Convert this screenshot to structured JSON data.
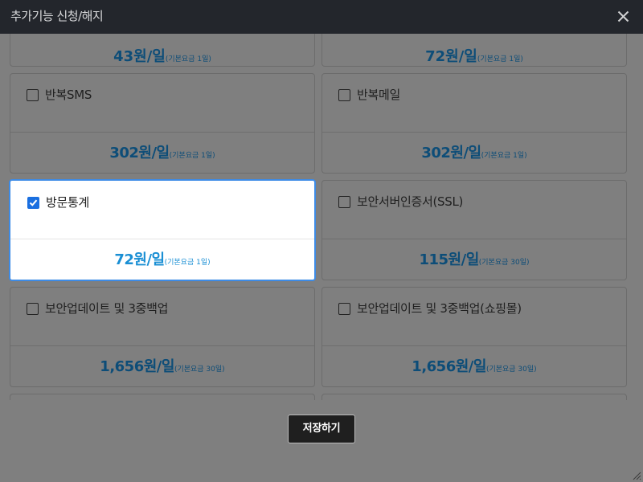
{
  "dialog": {
    "title": "추가기능 신청/해지",
    "close_icon": "close-icon"
  },
  "partial_top": [
    {
      "amount": "43원/일",
      "base": "(기본요금 1일)"
    },
    {
      "amount": "72원/일",
      "base": "(기본요금 1일)"
    }
  ],
  "options": [
    {
      "name": "반복SMS",
      "amount": "302원/일",
      "base": "(기본요금 1일)",
      "checked": false
    },
    {
      "name": "반복메일",
      "amount": "302원/일",
      "base": "(기본요금 1일)",
      "checked": false
    },
    {
      "name": "방문통계",
      "amount": "72원/일",
      "base": "(기본요금 1일)",
      "checked": true
    },
    {
      "name": "보안서버인증서(SSL)",
      "amount": "115원/일",
      "base": "(기본요금 30일)",
      "checked": false
    },
    {
      "name": "보안업데이트 및 3중백업",
      "amount": "1,656원/일",
      "base": "(기본요금 30일)",
      "checked": false
    },
    {
      "name": "보안업데이트 및 3중백업(쇼핑몰)",
      "amount": "1,656원/일",
      "base": "(기본요금 30일)",
      "checked": false
    }
  ],
  "footer": {
    "save_label": "저장하기"
  }
}
